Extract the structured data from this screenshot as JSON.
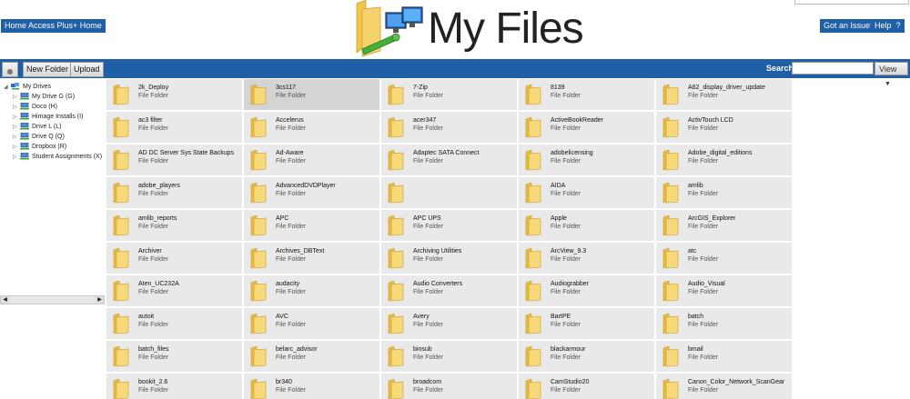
{
  "header": {
    "home_label": "Home Access Plus+ Home",
    "issue_label": "Got an Issue?",
    "help_label": "Help",
    "help_icon": "?",
    "title": "My Files"
  },
  "toolbar": {
    "new_folder_label": "New Folder",
    "upload_label": "Upload",
    "search_label": "Search:",
    "search_value": "",
    "view_label": "View",
    "accent_color": "#1f5fa6"
  },
  "tree": {
    "root_label": "My Drives",
    "drives": [
      {
        "label": "My Drive G (G)"
      },
      {
        "label": "Doco (H)"
      },
      {
        "label": "Himage Installs (I)"
      },
      {
        "label": "Drive L (L)"
      },
      {
        "label": "Drive Q (Q)"
      },
      {
        "label": "Dropbox (R)"
      },
      {
        "label": "Student Assignments (X)"
      }
    ]
  },
  "files": [
    {
      "name": "2k_Deploy",
      "type": "File Folder"
    },
    {
      "name": "3cs117",
      "type": "File Folder",
      "selected": true
    },
    {
      "name": "7-Zip",
      "type": "File Folder"
    },
    {
      "name": "8139",
      "type": "File Folder"
    },
    {
      "name": "A62_display_driver_update",
      "type": "File Folder"
    },
    {
      "name": "ac3 filter",
      "type": "File Folder"
    },
    {
      "name": "Accelerus",
      "type": "File Folder"
    },
    {
      "name": "acer347",
      "type": "File Folder"
    },
    {
      "name": "ActiveBookReader",
      "type": "File Folder"
    },
    {
      "name": "ActivTouch LCD",
      "type": "File Folder"
    },
    {
      "name": "AD DC Server Sys State Backups",
      "type": "File Folder"
    },
    {
      "name": "Ad-Aware",
      "type": "File Folder"
    },
    {
      "name": "Adaptec SATA Connect",
      "type": "File Folder"
    },
    {
      "name": "adobelicensing",
      "type": "File Folder"
    },
    {
      "name": "Adobe_digital_editions",
      "type": "File Folder"
    },
    {
      "name": "adobe_players",
      "type": "File Folder"
    },
    {
      "name": "AdvancedDVDPlayer",
      "type": "File Folder"
    },
    {
      "name": "",
      "type": ""
    },
    {
      "name": "AIDA",
      "type": "File Folder"
    },
    {
      "name": "amlib",
      "type": "File Folder"
    },
    {
      "name": "amlib_reports",
      "type": "File Folder"
    },
    {
      "name": "APC",
      "type": "File Folder"
    },
    {
      "name": "APC UPS",
      "type": "File Folder"
    },
    {
      "name": "Apple",
      "type": "File Folder"
    },
    {
      "name": "ArcGIS_Explorer",
      "type": "File Folder"
    },
    {
      "name": "Archiver",
      "type": "File Folder"
    },
    {
      "name": "Archives_DBText",
      "type": "File Folder"
    },
    {
      "name": "Archiving Utilities",
      "type": "File Folder"
    },
    {
      "name": "ArcView_9.3",
      "type": "File Folder"
    },
    {
      "name": "atc",
      "type": "File Folder"
    },
    {
      "name": "Aten_UC232A",
      "type": "File Folder"
    },
    {
      "name": "audacity",
      "type": "File Folder"
    },
    {
      "name": "Audio Converters",
      "type": "File Folder"
    },
    {
      "name": "Audiograbber",
      "type": "File Folder"
    },
    {
      "name": "Audio_Visual",
      "type": "File Folder"
    },
    {
      "name": "autoit",
      "type": "File Folder"
    },
    {
      "name": "AVC",
      "type": "File Folder"
    },
    {
      "name": "Avery",
      "type": "File Folder"
    },
    {
      "name": "BartPE",
      "type": "File Folder"
    },
    {
      "name": "batch",
      "type": "File Folder"
    },
    {
      "name": "batch_files",
      "type": "File Folder"
    },
    {
      "name": "belarc_advisor",
      "type": "File Folder"
    },
    {
      "name": "binsub",
      "type": "File Folder"
    },
    {
      "name": "blackarmour",
      "type": "File Folder"
    },
    {
      "name": "bmail",
      "type": "File Folder"
    },
    {
      "name": "bookit_2.6",
      "type": "File Folder"
    },
    {
      "name": "br340",
      "type": "File Folder"
    },
    {
      "name": "broadcom",
      "type": "File Folder"
    },
    {
      "name": "CamStudio20",
      "type": "File Folder"
    },
    {
      "name": "Canon_Color_Network_ScanGear",
      "type": "File Folder"
    }
  ]
}
